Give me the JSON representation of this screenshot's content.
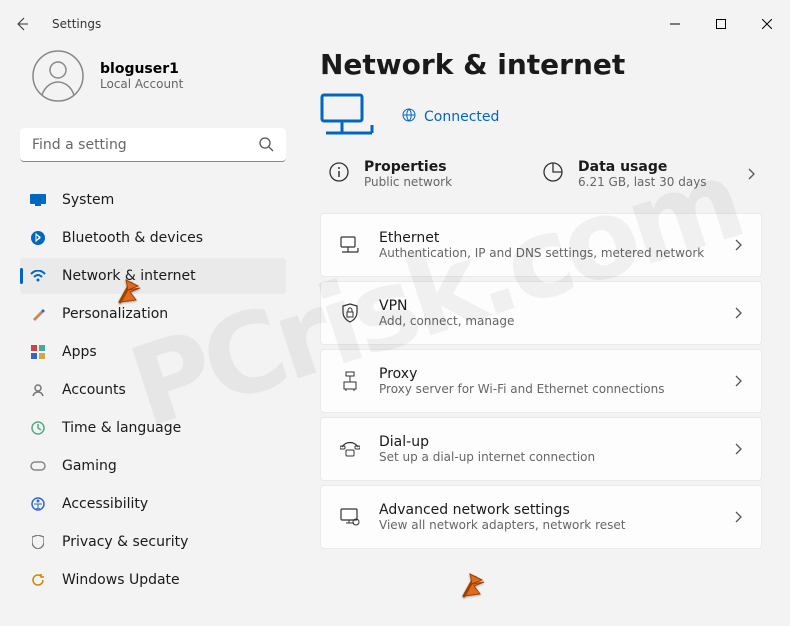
{
  "titlebar": {
    "app": "Settings"
  },
  "profile": {
    "name": "bloguser1",
    "sub": "Local Account"
  },
  "search": {
    "placeholder": "Find a setting"
  },
  "sidebar": {
    "items": [
      {
        "label": "System"
      },
      {
        "label": "Bluetooth & devices"
      },
      {
        "label": "Network & internet"
      },
      {
        "label": "Personalization"
      },
      {
        "label": "Apps"
      },
      {
        "label": "Accounts"
      },
      {
        "label": "Time & language"
      },
      {
        "label": "Gaming"
      },
      {
        "label": "Accessibility"
      },
      {
        "label": "Privacy & security"
      },
      {
        "label": "Windows Update"
      }
    ]
  },
  "page": {
    "title": "Network & internet",
    "status": "Connected",
    "top": {
      "properties_label": "Properties",
      "properties_sub": "Public network",
      "data_label": "Data usage",
      "data_sub": "6.21 GB, last 30 days"
    },
    "cards": [
      {
        "label": "Ethernet",
        "sub": "Authentication, IP and DNS settings, metered network"
      },
      {
        "label": "VPN",
        "sub": "Add, connect, manage"
      },
      {
        "label": "Proxy",
        "sub": "Proxy server for Wi-Fi and Ethernet connections"
      },
      {
        "label": "Dial-up",
        "sub": "Set up a dial-up internet connection"
      },
      {
        "label": "Advanced network settings",
        "sub": "View all network adapters, network reset"
      }
    ]
  }
}
